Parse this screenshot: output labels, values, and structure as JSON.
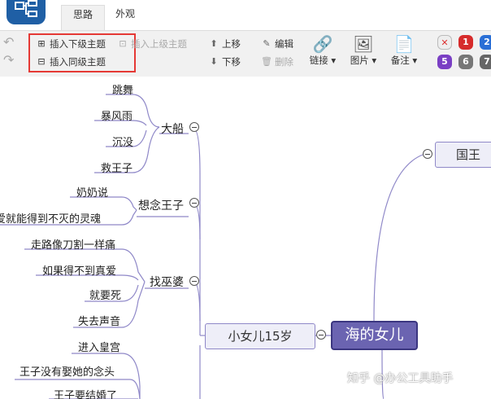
{
  "app": {
    "tabs": [
      "思路",
      "外观"
    ]
  },
  "toolbar": {
    "insert_child": "插入下级主题",
    "insert_sibling": "插入同级主题",
    "insert_parent": "插入上级主题",
    "move_up": "上移",
    "move_down": "下移",
    "edit": "编辑",
    "delete": "删除",
    "link": "链接",
    "image": "图片",
    "note": "备注",
    "priorities": [
      "1",
      "2",
      "5",
      "6",
      "7"
    ]
  },
  "mindmap": {
    "root": "海的女儿",
    "right_branch": "国王",
    "main_branch": "小女儿15岁",
    "groups": [
      {
        "label": "大船",
        "leaves": [
          "跳舞",
          "暴风雨",
          "沉没",
          "救王子"
        ]
      },
      {
        "label": "想念王子",
        "leaves": [
          "奶奶说",
          "爱就能得到不灭的灵魂"
        ]
      },
      {
        "label": "找巫婆",
        "leaves": [
          "走路像刀割一样痛",
          "如果得不到真爱",
          "就要死",
          "失去声音"
        ]
      }
    ],
    "extra_leaves": [
      "进入皇宫",
      "王子没有娶她的念头",
      "王子要结婚了"
    ]
  },
  "watermark": "知乎 @办公工具助手",
  "colors": {
    "branch": "#8f88c8",
    "root_fill": "#6b64b1",
    "highlight": "#e53935",
    "logo": "#1f5fa5"
  }
}
